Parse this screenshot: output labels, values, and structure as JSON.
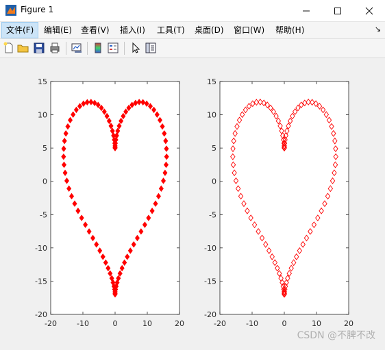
{
  "window": {
    "title": "Figure 1",
    "minimize_icon": "minimize-icon",
    "maximize_icon": "maximize-icon",
    "close_icon": "close-icon"
  },
  "menu": {
    "items": [
      {
        "label": "文件(F)"
      },
      {
        "label": "编辑(E)"
      },
      {
        "label": "查看(V)"
      },
      {
        "label": "插入(I)"
      },
      {
        "label": "工具(T)"
      },
      {
        "label": "桌面(D)"
      },
      {
        "label": "窗口(W)"
      },
      {
        "label": "帮助(H)"
      }
    ],
    "overflow": "↘"
  },
  "toolbar": {
    "icons": [
      "new-figure-icon",
      "open-icon",
      "save-icon",
      "print-icon",
      "link-plot-icon",
      "colorbar-icon",
      "legend-icon",
      "pointer-icon",
      "property-inspector-icon"
    ]
  },
  "chart_data": [
    {
      "type": "scatter",
      "marker": "diamond-filled",
      "color": "#ff0000",
      "curve": "x = 16*sin(t)^3, y = 13*cos(t) - 5*cos(2t) - 2*cos(3t) - cos(4t)",
      "t_range": [
        0,
        6.2832
      ],
      "point_count": 100,
      "xlim": [
        -20,
        20
      ],
      "ylim": [
        -20,
        15
      ],
      "xticks": [
        "-20",
        "-10",
        "0",
        "10",
        "20"
      ],
      "yticks": [
        "15",
        "10",
        "5",
        "0",
        "-5",
        "-10",
        "-15",
        "-20"
      ],
      "title": "",
      "xlabel": "",
      "ylabel": ""
    },
    {
      "type": "scatter",
      "marker": "diamond-open",
      "color": "#ff0000",
      "curve": "x = 16*sin(t)^3, y = 13*cos(t) - 5*cos(2t) - 2*cos(3t) - cos(4t)",
      "t_range": [
        0,
        6.2832
      ],
      "point_count": 100,
      "xlim": [
        -20,
        20
      ],
      "ylim": [
        -20,
        15
      ],
      "xticks": [
        "-20",
        "-10",
        "0",
        "10",
        "20"
      ],
      "yticks": [
        "15",
        "10",
        "5",
        "0",
        "-5",
        "-10",
        "-15",
        "-20"
      ],
      "title": "",
      "xlabel": "",
      "ylabel": ""
    }
  ],
  "watermark": "CSDN @不脾不改"
}
